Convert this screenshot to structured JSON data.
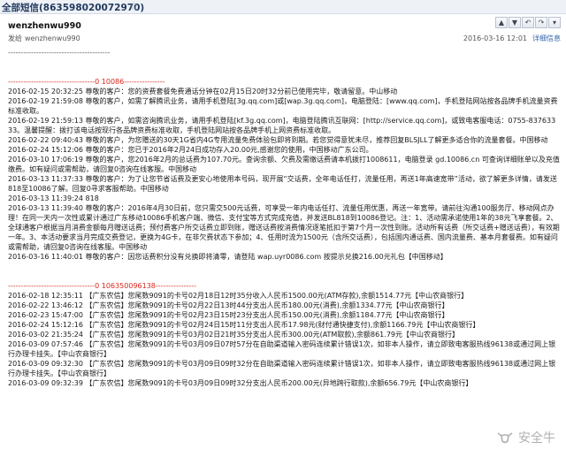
{
  "window": {
    "title": "全部短信(863598020072970)",
    "star_glyph": "☆"
  },
  "header": {
    "sender": "wenzhenwu990",
    "from_label": "发给",
    "recipient": "wenzhenwu990",
    "datetime": "2016-03-16 12:01",
    "details_link": "详细信息",
    "controls": [
      "▲",
      "▼",
      "↶",
      "↷",
      "▾"
    ]
  },
  "content": {
    "top_separator": "----------------------------------------",
    "block1_separator_prefix": "----------------------------------",
    "block1_sender": "0 10086",
    "block1_separator_suffix": "----------------",
    "block1": [
      "2016-02-15 20:32:25 尊敬的客户：您的资费套餐免费通话分钟在02月15日20时32分前已使用完毕，敬请留意。中山移动",
      "2016-02-19 21:59:08 尊敬的客户，如需了解腾讯业务，请用手机登陆[3g.qq.com]或[wap.3g.qq.com]，电脑登陆：[www.qq.com]，手机登陆网站按各品牌手机流量资费标准收取。",
      "2016-02-19 21:59:13 尊敬的客户，如需咨询腾讯业务，请用手机登陆[kf.3g.qq.com]，电脑登陆腾讯互联网：[http://service.qq.com]，或致电客服电话：0755-83763333。温馨提醒：拨打该电话按现行各品牌资费标准收取，手机登陆网站按各品牌手机上网资费标准收取。",
      "2016-02-22 09:40:43 尊敬的客户，为您赠送的30天1G省内4G专用流量免费体验包即将到期。若您觉得意犹未尽，推荐回复BLSJLL了解更多适合你的流量套餐。中国移动",
      "2016-02-24 15:12:06 尊敬的客户：您已于2016年2月24日成功存入20.00元,感谢您的使用，中国移动广东公司。",
      "2016-03-10 17:06:19 尊敬的客户，您2016年2月的总话费为107.70元。查询余额、欠费及需缴话费请本机拨打1008611，电脑登录 gd.10086.cn 可查询详细账单以及充值缴费。如有疑问或需帮助，请回复0咨询在线客服。中国移动",
      "2016-03-13 11:37:33 尊敬的客户：为了让您节省话费及更安心地使用本号码，现开展“交话费，全年电话任打，流量任用，再送1年高速宽带”活动，欲了解更多详情，请发送818至10086了解。回复0寻求客服帮助。中国移动",
      "2016-03-13 11:39:24 818",
      "2016-03-13 11:39:40 尊敬的客户：2016年4月30日前，您只需交500元话费，可享受一年内电话任打、流量任用优惠，再送一年宽带。请前往沟通100服务厅、移动网点办理！在同一天内一次性或累计通过广东移动10086手机客户端、微信、支付宝等方式完成充值，并发送BL818到10086登记。注：1、活动需承诺使用1年的38元飞享套餐。2、全球通客户根据当月消费金额每月赠送话费；预付费客户所交话费立即到账，赠送话费按消费情况逐笔抵扣于第7个月一次性到账。活动所有话费（所交话费+赠送话费），有效期一年。3、本活动要求当月完成交费登记，更换为4G卡，在非欠费状态下参加；4、任用时流为1500元（含所交话费），包括国内通话费、国内流量费、基本月套餐费。如有疑问或需帮助，请回复0咨询在线客服。中国移动",
      "2016-03-16 11:40:01 尊敬的客户：因您话费积分没有兑换即将清零，请登陆 wap.uyr0086.com 按提示兑换216.00元礼包【中国移动】"
    ],
    "block2_separator_prefix": "----------------------------------",
    "block2_sender": "0 106350096138",
    "block2_separator_suffix": "----------------",
    "block2": [
      "2016-02-18 12:35:11 【广东农信】您尾数9091的卡号02月18日12时35分收入人民币1500.00元(ATM存款),余额1514.77元【中山农商银行】",
      "2016-02-22 13:46:12 【广东农信】您尾数9091的卡号02月22日13时44分支出人民币180.00元(消费),余额1334.77元【中山农商银行】",
      "2016-02-23 15:47:00 【广东农信】您尾数9091的卡号02月23日15时23分支出人民币150.00元(消费),余额1184.77元【中山农商银行】",
      "2016-02-24 15:12:16 【广东农信】您尾数9091的卡号02月24日15时11分支出人民币17.98元(财付通快捷支付),余额1166.79元【中山农商银行】",
      "2016-03-02 21:35:24 【广东农信】您尾数9091的卡号03月02日21时35分支出人民币300.00元(ATM取款),余额861.79元【中山农商银行】",
      "2016-03-09 07:57:46 【广东农信】您尾数9091的卡号03月09日07时57分在自助渠道输入密码连续累计错误1次，如非本人操作，请立即致电客服热线96138或通过网上银行办理卡挂失。【中山农商银行】",
      "2016-03-09 09:32:30 【广东农信】您尾数9091的卡号03月09日09时32分在自助渠道输入密码连续累计错误1次，如非本人操作，请立即致电客服热线96138或通过网上银行办理卡挂失。【中山农商银行】",
      "2016-03-09 09:32:39 【广东农信】您尾数9091的卡号03月09日09时32分支出人民币200.00元(异地跨行取款),余额656.79元【中山农商银行】"
    ]
  },
  "watermark": {
    "text": "安全牛"
  }
}
